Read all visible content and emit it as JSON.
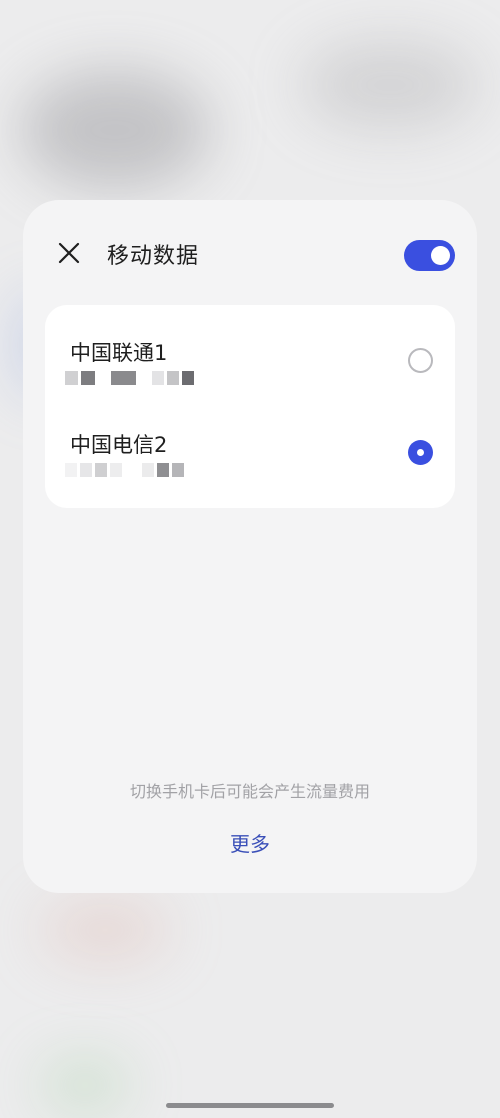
{
  "dialog": {
    "title": "移动数据",
    "toggle_on": true,
    "accent_color": "#3a4fe0"
  },
  "sims": [
    {
      "name": "中国联通1",
      "number": "",
      "selected": false
    },
    {
      "name": "中国电信2",
      "number": "",
      "selected": true
    }
  ],
  "footer": {
    "hint": "切换手机卡后可能会产生流量费用",
    "more_label": "更多"
  },
  "icons": {
    "close": "close-icon"
  }
}
